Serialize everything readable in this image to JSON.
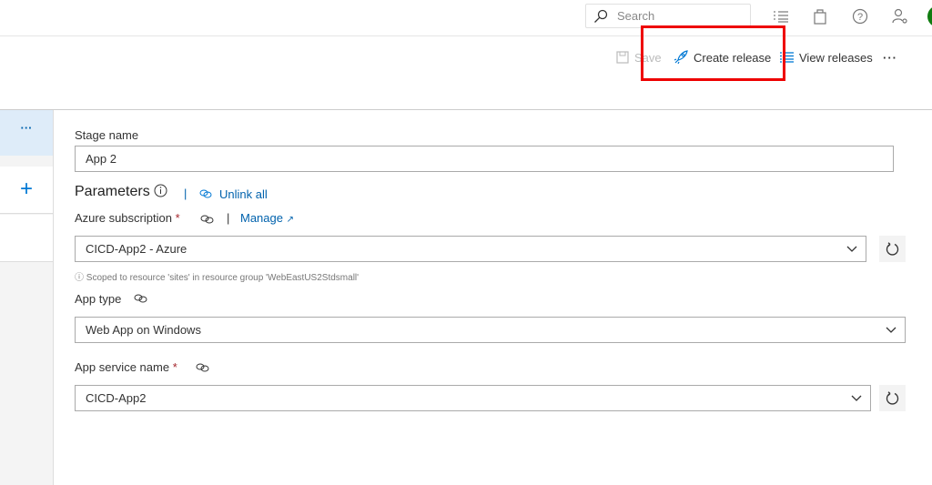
{
  "topbar": {
    "search_placeholder": "Search"
  },
  "toolbar": {
    "save": "Save",
    "create_release": "Create release",
    "view_releases": "View releases",
    "more": "···"
  },
  "left_pane": {
    "more": "···",
    "add": "+"
  },
  "form": {
    "stage_name_label": "Stage name",
    "stage_name_value": "App 2",
    "parameters_title": "Parameters",
    "unlink_all": "Unlink all",
    "azure_subscription_label": "Azure subscription",
    "required_mark": "*",
    "manage": "Manage",
    "azure_subscription_value": "CICD-App2 - Azure",
    "scope_note": "Scoped to resource 'sites' in resource group 'WebEastUS2Stdsmall'",
    "app_type_label": "App type",
    "app_type_value": "Web App on Windows",
    "app_service_label": "App service name",
    "app_service_value": "CICD-App2"
  }
}
